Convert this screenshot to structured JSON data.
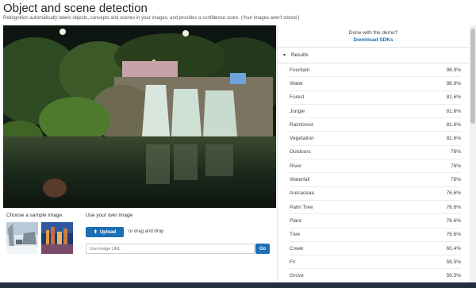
{
  "header": {
    "title": "Object and scene detection",
    "subtitle": "Rekognition automatically labels objects, concepts and scenes in your images, and provides a confidence score. (Your images aren't stored.)"
  },
  "main_image": {
    "icon": "waterfall-photo"
  },
  "sample": {
    "label": "Choose a sample image",
    "thumbnails": [
      {
        "icon": "snowy-street-photo"
      },
      {
        "icon": "city-skyline-photo"
      }
    ]
  },
  "own_image": {
    "label": "Use your own image",
    "upload_label": "Upload",
    "upload_icon": "upload-icon",
    "drag_text": "or drag and drop",
    "url_placeholder": "Use image URL",
    "go_label": "Go"
  },
  "demo": {
    "text": "Done with the demo?",
    "link": "Download SDKs"
  },
  "results": {
    "header": "Results",
    "items": [
      {
        "label": "Fountain",
        "score": "98.9%"
      },
      {
        "label": "Water",
        "score": "98.9%"
      },
      {
        "label": "Forest",
        "score": "81.6%"
      },
      {
        "label": "Jungle",
        "score": "81.6%"
      },
      {
        "label": "Rainforest",
        "score": "81.6%"
      },
      {
        "label": "Vegetation",
        "score": "81.6%"
      },
      {
        "label": "Outdoors",
        "score": "78%"
      },
      {
        "label": "River",
        "score": "78%"
      },
      {
        "label": "Waterfall",
        "score": "78%"
      },
      {
        "label": "Arecaceae",
        "score": "76.6%"
      },
      {
        "label": "Palm Tree",
        "score": "76.6%"
      },
      {
        "label": "Plant",
        "score": "76.6%"
      },
      {
        "label": "Tree",
        "score": "76.6%"
      },
      {
        "label": "Creek",
        "score": "60.4%"
      },
      {
        "label": "Fir",
        "score": "59.5%"
      },
      {
        "label": "Grove",
        "score": "59.5%"
      }
    ]
  },
  "colors": {
    "accent": "#1a6fb5",
    "footer": "#232f3e"
  }
}
